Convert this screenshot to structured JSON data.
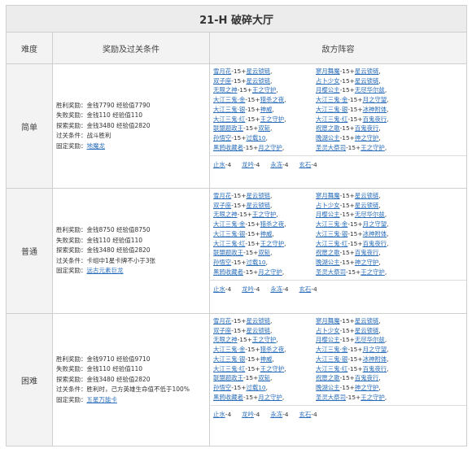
{
  "title": "21-H 破碎大厅",
  "headers": {
    "difficulty": "难度",
    "rewards": "奖励及过关条件",
    "enemies": "敌方阵容"
  },
  "rows": [
    {
      "difficulty": "简单",
      "reward_lines": [
        "胜利奖励：金钱7790 经验值7790",
        "失败奖励：金钱110 经验值110",
        "探索奖励：金钱3480 经验值2820",
        "过关条件：战斗胜利"
      ],
      "fixed_label": "固定奖励：",
      "fixed_link": "地魔龙",
      "enemies_left": [
        {
          "name": "雪月花",
          "suffix": "-15+",
          "tag": "星云锁链",
          "end": ","
        },
        {
          "name": "双子座",
          "suffix": "-15+",
          "tag": "星云锁链",
          "end": ","
        },
        {
          "name": "无限之神",
          "suffix": "-15+",
          "tag": "王之守护",
          "end": ","
        },
        {
          "name": "大江三鬼·金",
          "suffix": "-15+",
          "tag": "猎杀之夜",
          "end": ","
        },
        {
          "name": "大江三鬼·银",
          "suffix": "-15+",
          "tag": "神威",
          "end": ","
        },
        {
          "name": "大江三鬼·红",
          "suffix": "-15+",
          "tag": "王之守护",
          "end": ","
        },
        {
          "name": "联盟题政王",
          "suffix": "-15+",
          "tag": "双斩",
          "end": ","
        },
        {
          "name": "孙悟空",
          "suffix": "-15+",
          "tag": "过载10",
          "end": ","
        },
        {
          "name": "黑鸦收藏者",
          "suffix": "-15+",
          "tag": "月之守护",
          "end": ","
        }
      ],
      "enemies_right": [
        {
          "name": "寥月舞魔",
          "suffix": "-15+",
          "tag": "星云锁链",
          "end": ","
        },
        {
          "name": "占卜少女",
          "suffix": "-15+",
          "tag": "星云锁链",
          "end": ","
        },
        {
          "name": "月樱公主",
          "suffix": "-15+",
          "tag": "无尽华尔兹",
          "end": ","
        },
        {
          "name": "大江三鬼·金",
          "suffix": "-15+",
          "tag": "月之守望",
          "end": ","
        },
        {
          "name": "大江三鬼·银",
          "suffix": "-15+",
          "tag": "冰神附体",
          "end": ","
        },
        {
          "name": "大江三鬼·红",
          "suffix": "-15+",
          "tag": "百鬼夜行",
          "end": ","
        },
        {
          "name": "祝愿之歌",
          "suffix": "-15+",
          "tag": "百鬼夜行",
          "end": ","
        },
        {
          "name": "晚湖公主",
          "suffix": "-15+",
          "tag": "神之守护",
          "end": ","
        },
        {
          "name": "圣灵大祭司",
          "suffix": "-15+",
          "tag": "王之守护",
          "end": ","
        }
      ],
      "bottom": [
        {
          "name": "止水",
          "suffix": "-4"
        },
        {
          "name": "龙吟",
          "suffix": "-4"
        },
        {
          "name": "永冻",
          "suffix": "-4"
        },
        {
          "name": "玄石",
          "suffix": "-4"
        }
      ]
    },
    {
      "difficulty": "普通",
      "reward_lines": [
        "胜利奖励：金钱8750 经验值8750",
        "失败奖励：金钱110 经验值110",
        "探索奖励：金钱3480 经验值2820",
        "过关条件：卡组中1星卡牌不小于3张"
      ],
      "fixed_label": "固定奖励：",
      "fixed_link": "远古元素巨龙",
      "enemies_left": [
        {
          "name": "雪月花",
          "suffix": "-15+",
          "tag": "星云锁链",
          "end": ","
        },
        {
          "name": "双子座",
          "suffix": "-15+",
          "tag": "星云锁链",
          "end": ","
        },
        {
          "name": "无限之神",
          "suffix": "-15+",
          "tag": "王之守护",
          "end": ","
        },
        {
          "name": "大江三鬼·金",
          "suffix": "-15+",
          "tag": "猎杀之夜",
          "end": ","
        },
        {
          "name": "大江三鬼·银",
          "suffix": "-15+",
          "tag": "神威",
          "end": ","
        },
        {
          "name": "大江三鬼·红",
          "suffix": "-15+",
          "tag": "王之守护",
          "end": ","
        },
        {
          "name": "联盟题政王",
          "suffix": "-15+",
          "tag": "双斩",
          "end": ","
        },
        {
          "name": "孙悟空",
          "suffix": "-15+",
          "tag": "过载10",
          "end": ","
        },
        {
          "name": "黑鸦收藏者",
          "suffix": "-15+",
          "tag": "月之守护",
          "end": ","
        }
      ],
      "enemies_right": [
        {
          "name": "寥月舞魔",
          "suffix": "-15+",
          "tag": "星云锁链",
          "end": ","
        },
        {
          "name": "占卜少女",
          "suffix": "-15+",
          "tag": "星云锁链",
          "end": ","
        },
        {
          "name": "月樱公主",
          "suffix": "-15+",
          "tag": "无尽华尔兹",
          "end": ","
        },
        {
          "name": "大江三鬼·金",
          "suffix": "-15+",
          "tag": "月之守望",
          "end": ","
        },
        {
          "name": "大江三鬼·银",
          "suffix": "-15+",
          "tag": "冰神附体",
          "end": ","
        },
        {
          "name": "大江三鬼·红",
          "suffix": "-15+",
          "tag": "百鬼夜行",
          "end": ","
        },
        {
          "name": "祝愿之歌",
          "suffix": "-15+",
          "tag": "百鬼夜行",
          "end": ","
        },
        {
          "name": "晚湖公主",
          "suffix": "-15+",
          "tag": "神之守护",
          "end": ","
        },
        {
          "name": "圣灵大祭司",
          "suffix": "-15+",
          "tag": "王之守护",
          "end": ","
        }
      ],
      "bottom": [
        {
          "name": "止水",
          "suffix": "-4"
        },
        {
          "name": "龙吟",
          "suffix": "-4"
        },
        {
          "name": "永冻",
          "suffix": "-4"
        },
        {
          "name": "玄石",
          "suffix": "-4"
        }
      ]
    },
    {
      "difficulty": "困难",
      "reward_lines": [
        "胜利奖励：金钱9710 经验值9710",
        "失败奖励：金钱110 经验值110",
        "探索奖励：金钱3480 经验值2820",
        "过关条件：胜利时，己方英雄生命值不低于100%"
      ],
      "fixed_label": "固定奖励：",
      "fixed_link": "五星万能卡",
      "enemies_left": [
        {
          "name": "雪月花",
          "suffix": "-15+",
          "tag": "星云锁链",
          "end": ","
        },
        {
          "name": "双子座",
          "suffix": "-15+",
          "tag": "星云锁链",
          "end": ","
        },
        {
          "name": "无限之神",
          "suffix": "-15+",
          "tag": "王之守护",
          "end": ","
        },
        {
          "name": "大江三鬼·金",
          "suffix": "-15+",
          "tag": "猎杀之夜",
          "end": ","
        },
        {
          "name": "大江三鬼·银",
          "suffix": "-15+",
          "tag": "神威",
          "end": ","
        },
        {
          "name": "大江三鬼·红",
          "suffix": "-15+",
          "tag": "王之守护",
          "end": ","
        },
        {
          "name": "联盟题政王",
          "suffix": "-15+",
          "tag": "双斩",
          "end": ","
        },
        {
          "name": "孙悟空",
          "suffix": "-15+",
          "tag": "过载10",
          "end": ","
        },
        {
          "name": "黑鸦收藏者",
          "suffix": "-15+",
          "tag": "月之守护",
          "end": ","
        }
      ],
      "enemies_right": [
        {
          "name": "寥月舞魔",
          "suffix": "-15+",
          "tag": "星云锁链",
          "end": ","
        },
        {
          "name": "占卜少女",
          "suffix": "-15+",
          "tag": "星云锁链",
          "end": ","
        },
        {
          "name": "月樱公主",
          "suffix": "-15+",
          "tag": "无尽华尔兹",
          "end": ","
        },
        {
          "name": "大江三鬼·金",
          "suffix": "-15+",
          "tag": "月之守望",
          "end": ","
        },
        {
          "name": "大江三鬼·银",
          "suffix": "-15+",
          "tag": "冰神附体",
          "end": ","
        },
        {
          "name": "大江三鬼·红",
          "suffix": "-15+",
          "tag": "百鬼夜行",
          "end": ","
        },
        {
          "name": "祝愿之歌",
          "suffix": "-15+",
          "tag": "百鬼夜行",
          "end": ","
        },
        {
          "name": "晚湖公主",
          "suffix": "-15+",
          "tag": "神之守护",
          "end": ","
        },
        {
          "name": "圣灵大祭司",
          "suffix": "-15+",
          "tag": "王之守护",
          "end": ","
        }
      ],
      "bottom": [
        {
          "name": "止水",
          "suffix": "-4"
        },
        {
          "name": "龙吟",
          "suffix": "-4"
        },
        {
          "name": "永冻",
          "suffix": "-4"
        },
        {
          "name": "玄石",
          "suffix": "-4"
        }
      ]
    }
  ]
}
